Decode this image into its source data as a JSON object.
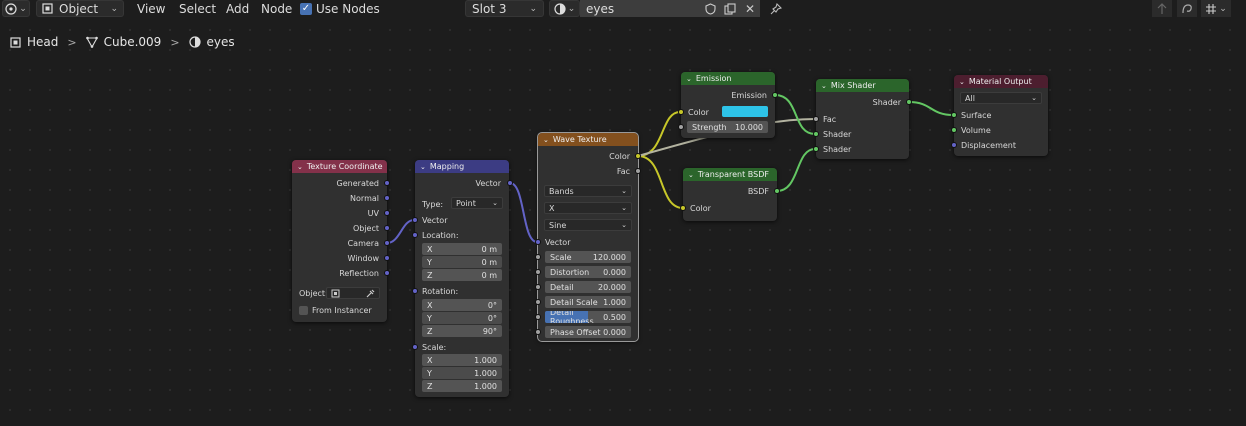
{
  "header": {
    "mode": "Object",
    "menus": [
      "View",
      "Select",
      "Add",
      "Node"
    ],
    "use_nodes_label": "Use Nodes",
    "slot": "Slot 3",
    "material_name": "eyes"
  },
  "breadcrumb": {
    "object": "Head",
    "mesh": "Cube.009",
    "material": "eyes"
  },
  "nodes": {
    "texcoord": {
      "title": "Texture Coordinate",
      "outputs": [
        "Generated",
        "Normal",
        "UV",
        "Object",
        "Camera",
        "Window",
        "Reflection"
      ],
      "object_label": "Object:",
      "from_instancer": "From Instancer"
    },
    "mapping": {
      "title": "Mapping",
      "output": "Vector",
      "type_label": "Type:",
      "type_value": "Point",
      "vector_label": "Vector",
      "location_label": "Location:",
      "location": [
        {
          "axis": "X",
          "value": "0 m"
        },
        {
          "axis": "Y",
          "value": "0 m"
        },
        {
          "axis": "Z",
          "value": "0 m"
        }
      ],
      "rotation_label": "Rotation:",
      "rotation": [
        {
          "axis": "X",
          "value": "0°"
        },
        {
          "axis": "Y",
          "value": "0°"
        },
        {
          "axis": "Z",
          "value": "90°"
        }
      ],
      "scale_label": "Scale:",
      "scale": [
        {
          "axis": "X",
          "value": "1.000"
        },
        {
          "axis": "Y",
          "value": "1.000"
        },
        {
          "axis": "Z",
          "value": "1.000"
        }
      ]
    },
    "wave": {
      "title": "Wave Texture",
      "outputs": [
        "Color",
        "Fac"
      ],
      "wave_type": "Bands",
      "direction": "X",
      "profile": "Sine",
      "vector_label": "Vector",
      "fields": [
        {
          "label": "Scale",
          "value": "120.000"
        },
        {
          "label": "Distortion",
          "value": "0.000"
        },
        {
          "label": "Detail",
          "value": "20.000"
        },
        {
          "label": "Detail Scale",
          "value": "1.000"
        },
        {
          "label": "Detail Roughness",
          "value": "0.500"
        },
        {
          "label": "Phase Offset",
          "value": "0.000"
        }
      ],
      "detail_roughness_fill": 0.5
    },
    "emission": {
      "title": "Emission",
      "output": "Emission",
      "color_label": "Color",
      "color_value": "#2ec4e9",
      "strength_label": "Strength",
      "strength": "10.000"
    },
    "transparent": {
      "title": "Transparent BSDF",
      "output": "BSDF",
      "color_label": "Color"
    },
    "mix": {
      "title": "Mix Shader",
      "output": "Shader",
      "inputs": [
        "Fac",
        "Shader",
        "Shader"
      ]
    },
    "output": {
      "title": "Material Output",
      "target": "All",
      "inputs": [
        "Surface",
        "Volume",
        "Displacement"
      ]
    }
  },
  "colors": {
    "input_header": "#83314a",
    "vector_header": "#3c3c83",
    "texture_header": "#83501e",
    "shader_header": "#2b652b",
    "output_header": "#4d1e2f"
  }
}
